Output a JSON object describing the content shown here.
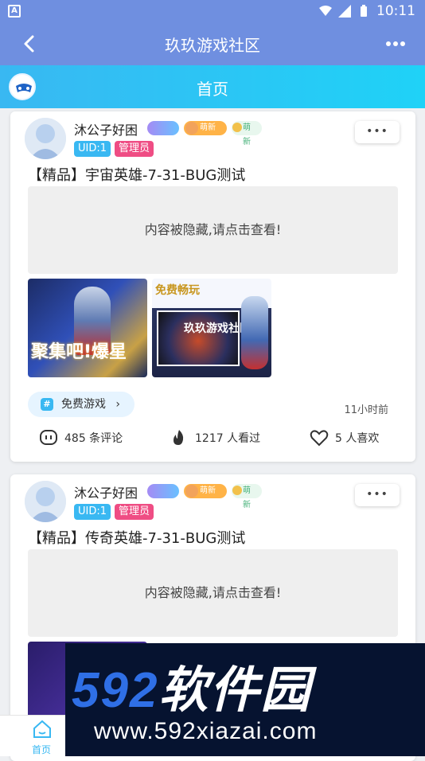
{
  "status_bar": {
    "time": "10:11",
    "left_indicator": "A"
  },
  "app_bar": {
    "title": "玖玖游戏社区"
  },
  "tab_header": {
    "title": "首页"
  },
  "posts": [
    {
      "username": "沐公子好困",
      "badges": [
        "",
        "萌新",
        "萌新"
      ],
      "uid_tag": "UID:1",
      "role_tag": "管理员",
      "menu_label": "•••",
      "title": "【精品】宇宙英雄-7-31-BUG测试",
      "hidden_text": "内容被隐藏,请点击查看!",
      "images": [
        {
          "overlay_text": "聚集吧!爆星"
        },
        {
          "top_text": "免费畅玩",
          "overlay_text": "玖玖游戏社区"
        }
      ],
      "game_tag": "免费游戏",
      "time_ago": "11小时前",
      "comments": "485 条评论",
      "views": "1217 人看过",
      "likes": "5 人喜欢"
    },
    {
      "username": "沐公子好困",
      "badges": [
        "",
        "萌新",
        "萌新"
      ],
      "uid_tag": "UID:1",
      "role_tag": "管理员",
      "menu_label": "•••",
      "title": "【精品】传奇英雄-7-31-BUG测试",
      "hidden_text": "内容被隐藏,请点击查看!"
    }
  ],
  "bottom_nav": {
    "home_label": "首页"
  },
  "watermark": {
    "line1_num": "592",
    "line1_txt": "软件园",
    "line2": "www.592xiazai.com"
  },
  "colors": {
    "app_bar": "#6f8fe0",
    "tab_header": "#39b8f2",
    "uid": "#39b8f2",
    "admin": "#ef4d84"
  }
}
